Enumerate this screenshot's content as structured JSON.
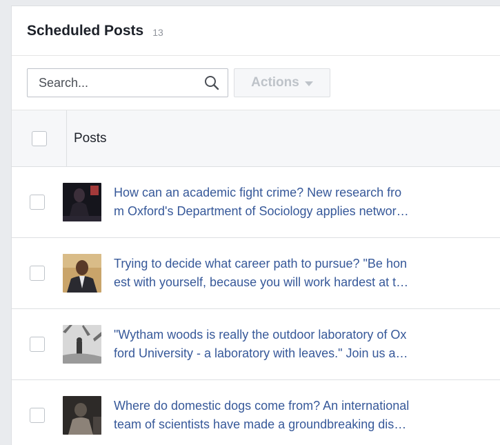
{
  "header": {
    "title": "Scheduled Posts",
    "count": "13"
  },
  "toolbar": {
    "search_placeholder": "Search...",
    "search_icon": "search-icon",
    "actions_label": "Actions"
  },
  "table": {
    "column_header": "Posts",
    "rows": [
      {
        "line1": "How can an academic fight crime? New research fro",
        "line2": "m Oxford's Department of Sociology applies networ…",
        "thumb_colors": [
          "#1a1a22",
          "#3b2f3a",
          "#a33a3a"
        ]
      },
      {
        "line1": "Trying to decide what career path to pursue? \"Be hon",
        "line2": "est with yourself, because you will work hardest at t…",
        "thumb_colors": [
          "#c9a46a",
          "#5a3a28",
          "#2a2a30"
        ]
      },
      {
        "line1": "\"Wytham woods is really the outdoor laboratory of Ox",
        "line2": "ford University - a laboratory with leaves.\" Join us a…",
        "thumb_colors": [
          "#d8d8d8",
          "#7a7a7a",
          "#3a3a3a"
        ]
      },
      {
        "line1": "Where do domestic dogs come from? An international",
        "line2": "team of scientists have made a groundbreaking dis…",
        "thumb_colors": [
          "#2d2a28",
          "#5e564e",
          "#8c8278"
        ]
      }
    ]
  },
  "colors": {
    "link": "#365899",
    "background": "#e9ebee",
    "header_fill": "#f6f7f9"
  }
}
